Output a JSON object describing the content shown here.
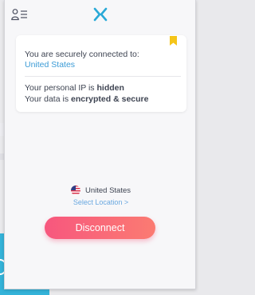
{
  "header": {
    "menu_icon": "user-list-icon",
    "logo_icon": "x-logo-icon",
    "brand_color": "#29a9d7"
  },
  "status_card": {
    "bookmark_icon": "bookmark-icon",
    "bookmark_color": "#f5c518",
    "connected_text": "You are securely connected to:",
    "connected_country": "United States",
    "ip_prefix": "Your personal IP is ",
    "ip_status": "hidden",
    "data_prefix": "Your data is ",
    "data_status": "encrypted & secure"
  },
  "location": {
    "flag_icon": "us-flag-icon",
    "name": "United States",
    "select_label": "Select Location >"
  },
  "action": {
    "disconnect_label": "Disconnect",
    "gradient": [
      "#f7577e",
      "#fb7b72"
    ]
  }
}
